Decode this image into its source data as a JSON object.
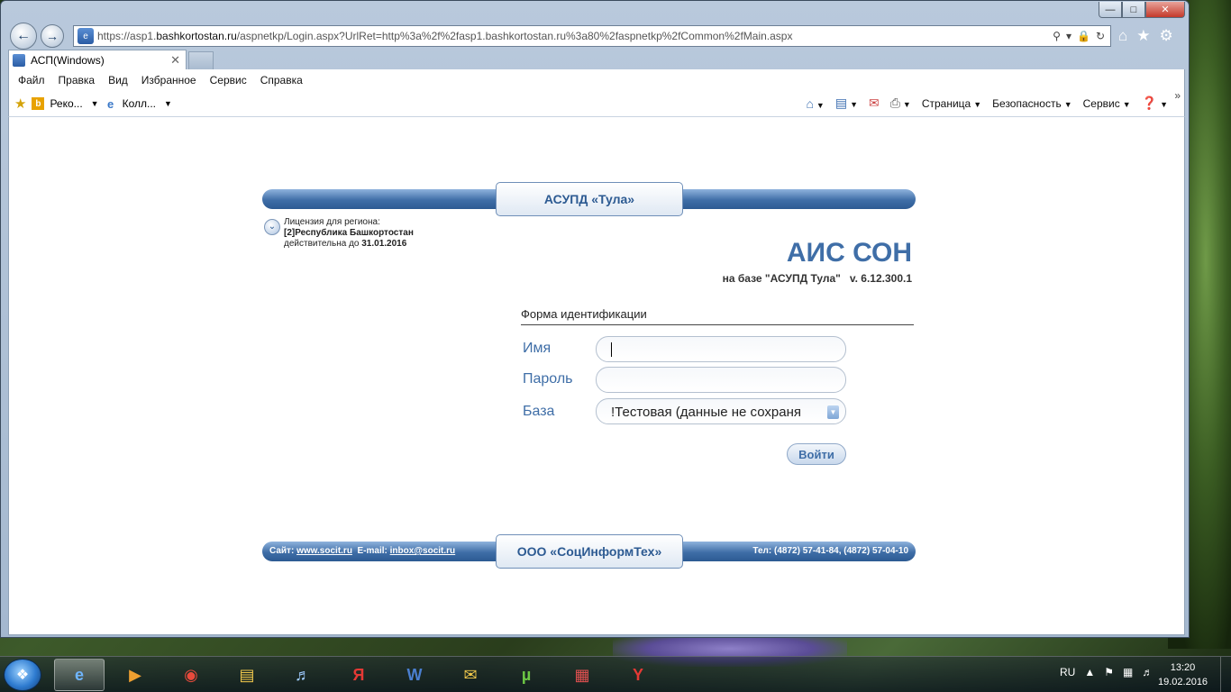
{
  "browser": {
    "url_prefix": "https://asp1.",
    "url_host": "bashkortostan.ru",
    "url_path": "/aspnetkp/Login.aspx?UrlRet=http%3a%2f%2fasp1.bashkortostan.ru%3a80%2faspnetkp%2fCommon%2fMain.aspx",
    "tab_title": "АСП(Windows)",
    "menu": [
      "Файл",
      "Правка",
      "Вид",
      "Избранное",
      "Сервис",
      "Справка"
    ],
    "fav_items": [
      "Реко...",
      "Колл..."
    ],
    "cmd": {
      "page": "Страница",
      "security": "Безопасность",
      "service": "Сервис"
    }
  },
  "header": {
    "badge": "АСУПД «Тула»"
  },
  "license": {
    "line1": "Лицензия для региона:",
    "region": "[2]Республика Башкортостан",
    "valid_prefix": "действительна до",
    "valid_date": "31.01.2016"
  },
  "app": {
    "title": "АИС СОН",
    "subtitle": "на базе \"АСУПД Тула\"",
    "version": "v. 6.12.300.1"
  },
  "form": {
    "title": "Форма идентификации",
    "name_label": "Имя",
    "password_label": "Пароль",
    "db_label": "База",
    "db_value": "!Тестовая (данные не сохраня",
    "login_button": "Войти"
  },
  "footer": {
    "site_label": "Сайт:",
    "site": "www.socit.ru",
    "email_label": "E-mail:",
    "email": "inbox@socit.ru",
    "company": "ООО «СоцИнформТех»",
    "phone_label": "Тел:",
    "phones": "(4872) 57-41-84, (4872) 57-04-10"
  },
  "taskbar": {
    "lang": "RU",
    "time": "13:20",
    "date": "19.02.2016"
  }
}
